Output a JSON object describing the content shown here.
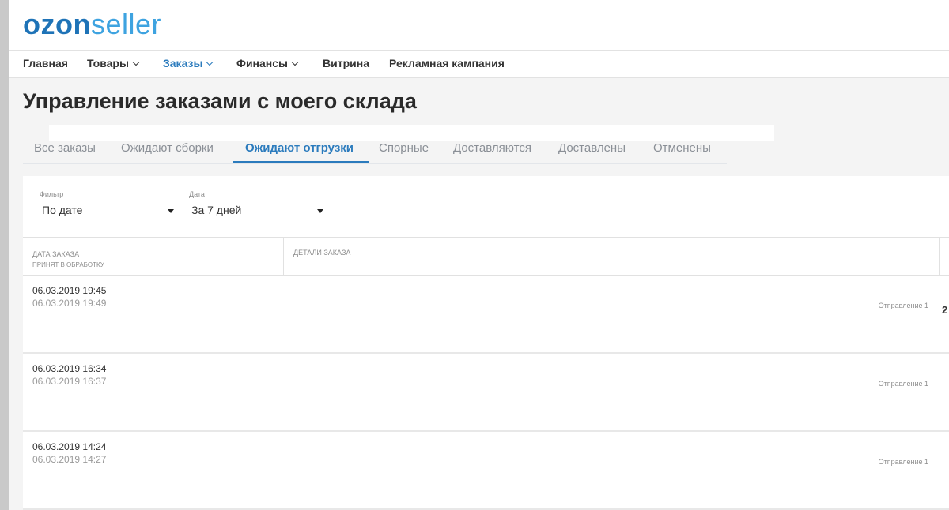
{
  "logo": {
    "part1": "ozon",
    "part2": "seller"
  },
  "nav": {
    "items": [
      {
        "label": "Главная",
        "dropdown": false,
        "active": false
      },
      {
        "label": "Товары",
        "dropdown": true,
        "active": false
      },
      {
        "label": "Заказы",
        "dropdown": true,
        "active": true
      },
      {
        "label": "Финансы",
        "dropdown": true,
        "active": false
      },
      {
        "label": "Витрина",
        "dropdown": false,
        "active": false
      },
      {
        "label": "Рекламная кампания",
        "dropdown": false,
        "active": false
      }
    ]
  },
  "page": {
    "title": "Управление заказами с моего склада"
  },
  "tabs": [
    {
      "label": "Все заказы"
    },
    {
      "label": "Ожидают сборки"
    },
    {
      "label": "Ожидают отгрузки",
      "active": true
    },
    {
      "label": "Спорные"
    },
    {
      "label": "Доставляются"
    },
    {
      "label": "Доставлены"
    },
    {
      "label": "Отменены"
    }
  ],
  "filters": {
    "filter": {
      "label": "Фильтр",
      "value": "По дате"
    },
    "date": {
      "label": "Дата",
      "value": "За 7 дней"
    }
  },
  "table": {
    "headers": {
      "order_date": "Дата заказа",
      "order_date_sub": "Принят в обработку",
      "details": "Детали заказа"
    },
    "rows": [
      {
        "date": "06.03.2019 19:45",
        "processed": "06.03.2019 19:49",
        "shipment": "Отправление 1",
        "extra": "2"
      },
      {
        "date": "06.03.2019 16:34",
        "processed": "06.03.2019 16:37",
        "shipment": "Отправление 1"
      },
      {
        "date": "06.03.2019 14:24",
        "processed": "06.03.2019 14:27",
        "shipment": "Отправление 1"
      }
    ]
  },
  "colors": {
    "brand_dark": "#1e73b7",
    "brand_light": "#3ea3e0",
    "accent": "#2b7bbd"
  },
  "icons": {
    "nav_dropdown": "chevron-down-icon",
    "select_dropdown": "caret-down-icon"
  }
}
